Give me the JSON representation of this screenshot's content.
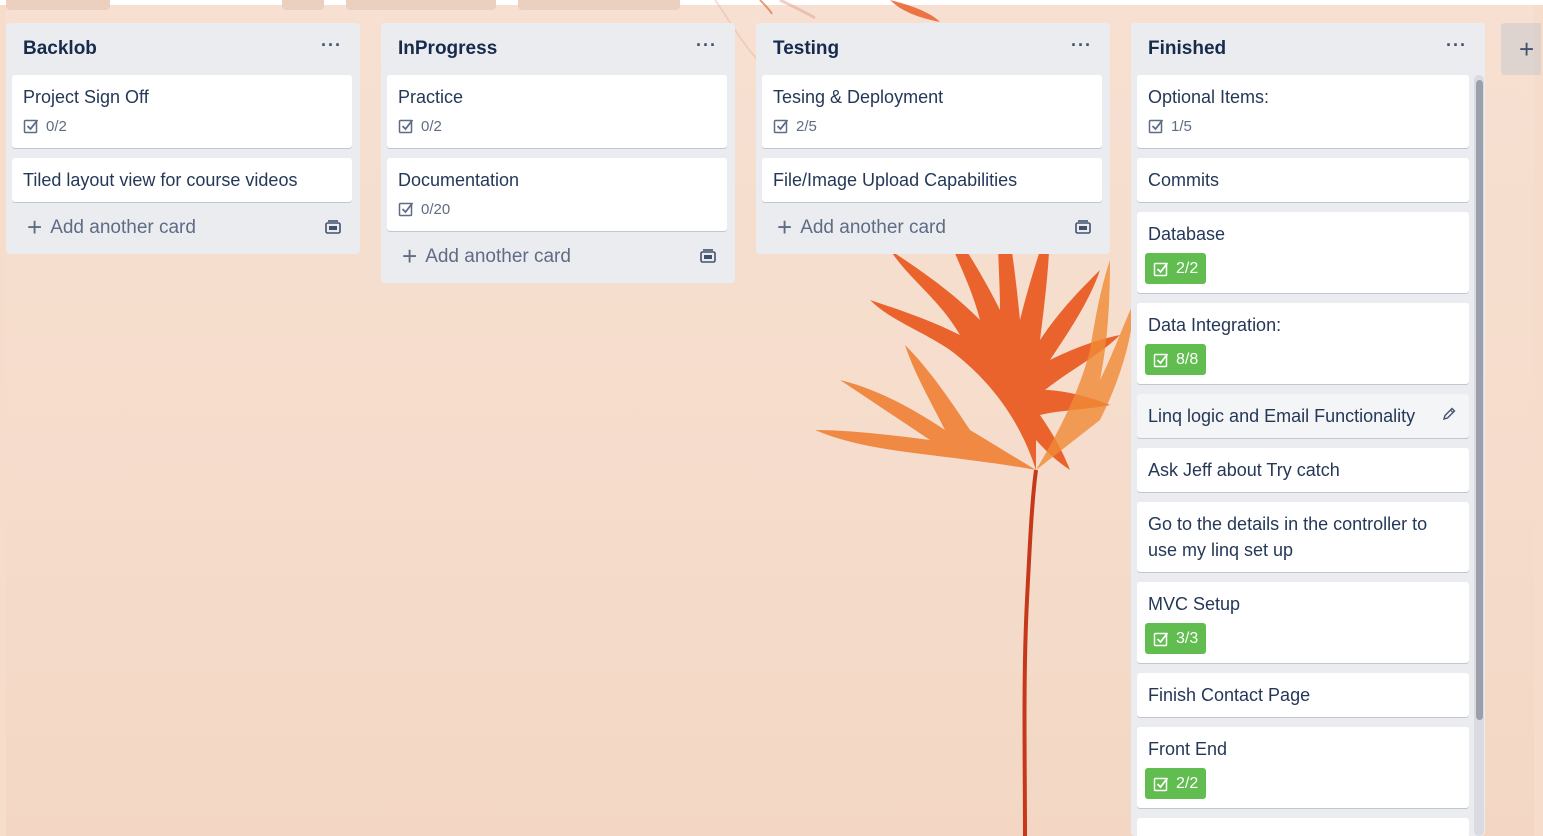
{
  "board": {
    "add_list_label": "+",
    "lists": [
      {
        "title": "Backlob",
        "menu": "···",
        "cards": [
          {
            "title": "Project Sign Off",
            "checklist": "0/2",
            "done": false
          },
          {
            "title": "Tiled layout view for course videos"
          }
        ],
        "add_card": "Add another card"
      },
      {
        "title": "InProgress",
        "menu": "···",
        "cards": [
          {
            "title": "Practice",
            "checklist": "0/2",
            "done": false
          },
          {
            "title": "Documentation",
            "checklist": "0/20",
            "done": false
          }
        ],
        "add_card": "Add another card"
      },
      {
        "title": "Testing",
        "menu": "···",
        "cards": [
          {
            "title": "Tesing & Deployment",
            "checklist": "2/5",
            "done": false
          },
          {
            "title": "File/Image Upload Capabilities"
          }
        ],
        "add_card": "Add another card"
      },
      {
        "title": "Finished",
        "menu": "···",
        "cards": [
          {
            "title": "Optional Items:",
            "checklist": "1/5",
            "done": false
          },
          {
            "title": "Commits"
          },
          {
            "title": "Database",
            "checklist": "2/2",
            "done": true
          },
          {
            "title": "Data Integration:",
            "checklist": "8/8",
            "done": true
          },
          {
            "title": "Linq logic and Email Functionality"
          },
          {
            "title": "Ask Jeff about Try catch"
          },
          {
            "title": "Go to the details in the controller to use my linq set up"
          },
          {
            "title": "MVC Setup",
            "checklist": "3/3",
            "done": true
          },
          {
            "title": "Finish Contact Page"
          },
          {
            "title": "Front End",
            "checklist": "2/2",
            "done": true
          }
        ]
      }
    ]
  },
  "colors": {
    "list_bg": "#ebecf0",
    "done_badge": "#61bd4f",
    "background": "#f6dccb"
  }
}
